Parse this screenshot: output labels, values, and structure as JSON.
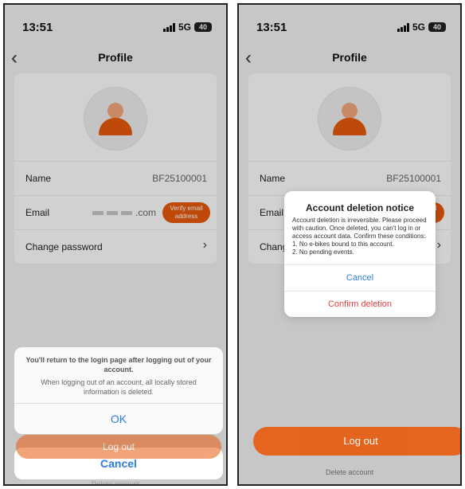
{
  "status_bar": {
    "time": "13:51",
    "network": "5G",
    "battery": "40"
  },
  "nav": {
    "title": "Profile"
  },
  "profile": {
    "name_label": "Name",
    "name_value": "BF25100001",
    "email_label": "Email",
    "email_suffix": ".com",
    "verify_label": "Verify email address",
    "change_password_label": "Change password"
  },
  "logout_label": "Log out",
  "delete_account_label": "Delete account",
  "logout_sheet": {
    "message": "You'll return to the login page after logging out of your account.",
    "detail": "When logging out of an account, all locally stored information is deleted.",
    "ok_label": "OK",
    "cancel_label": "Cancel"
  },
  "deletion_alert": {
    "title": "Account deletion notice",
    "body": "Account deletion is irreversible. Please proceed with caution. Once deleted, you can't log in or access account data. Confirm these conditions:",
    "condition_1": "1. No e-bikes bound to this account.",
    "condition_2": "2. No pending events.",
    "cancel_label": "Cancel",
    "confirm_label": "Confirm deletion"
  },
  "colors": {
    "accent": "#e85a0c",
    "link": "#2f7de1",
    "danger": "#e04040"
  }
}
